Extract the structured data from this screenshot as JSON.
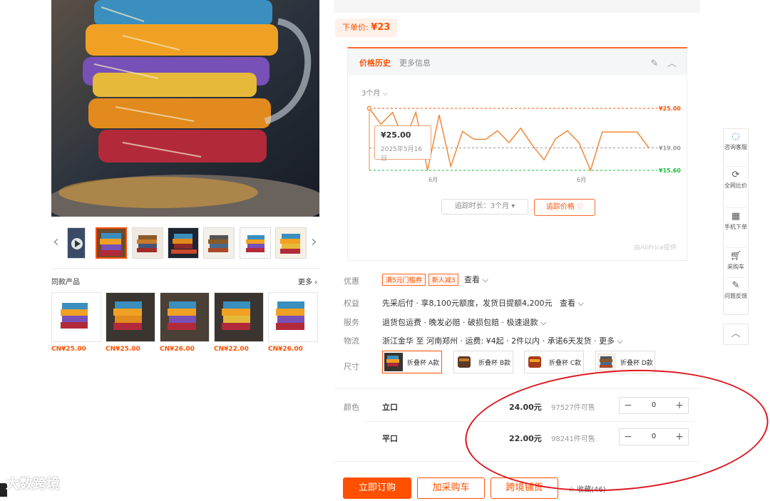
{
  "lowest_price": {
    "label": "下单价:",
    "price": "¥23"
  },
  "price_history": {
    "tab_active": "价格历史",
    "tab_more": "更多信息",
    "period_selector": "3个月",
    "tooltip_price": "¥25.00",
    "tooltip_date": "2025年5月16日",
    "track_duration_button": "追踪时长：3个月",
    "track_price_button": "追踪价格",
    "credit": "由AliPrice提供",
    "colors": {
      "line": "#f0883a",
      "max": "#ff5000",
      "min": "#19be3a"
    }
  },
  "chart_data": {
    "type": "line",
    "x_tick_labels": [
      "6月",
      "6月"
    ],
    "y_labels": [
      "¥25.00",
      "¥19.00",
      "¥15.60"
    ],
    "max": 25.0,
    "mid": 19.0,
    "min": 15.6,
    "series": [
      {
        "values": [
          25.0,
          22.6,
          24.4,
          20.0,
          24.4,
          15.6,
          24.0,
          16.2,
          21.5,
          20.3,
          20.3,
          21.6,
          19.8,
          22.0,
          19.4,
          17.2,
          20.4,
          21.6,
          19.8,
          15.6,
          21.4,
          21.4,
          21.4,
          21.4,
          19.0
        ]
      }
    ]
  },
  "attributes": {
    "promo": {
      "label": "优惠",
      "coupons": [
        "满5元门槛券",
        "新人减3"
      ],
      "link": "查看"
    },
    "rights": {
      "label": "权益",
      "value": "先采后付 · 享8,100元额度，发货日提额4,200元",
      "link": "查看"
    },
    "service": {
      "label": "服务",
      "value": "退货包运费 · 晚发必赔 · 破损包赔 · 极速退款"
    },
    "logistics": {
      "label": "物流",
      "value": "浙江金华 至 河南郑州 · 运费: ¥4起 · 2件以内 · 承诺6天发货 · 更多"
    },
    "size": {
      "label": "尺寸",
      "options": [
        "折叠杯 A款",
        "折叠杯 B款",
        "折叠杯 C款",
        "折叠杯 D款"
      ]
    }
  },
  "color_section": {
    "label": "颜色",
    "variants": [
      {
        "name": "立口",
        "price": "24.00元",
        "stock": "97527件可售",
        "qty": "0"
      },
      {
        "name": "平口",
        "price": "22.00元",
        "stock": "98241件可售",
        "qty": "0"
      }
    ]
  },
  "actions": {
    "buy_now": "立即订购",
    "add_to_cart": "加采购车",
    "cross_border": "跨境铺货",
    "favorite": "收藏(46)"
  },
  "similar": {
    "title": "同款产品",
    "more": "更多",
    "items": [
      {
        "price": "CN¥25.00"
      },
      {
        "price": "CN¥25.00"
      },
      {
        "price": "CN¥26.00"
      },
      {
        "price": "CN¥22.00"
      },
      {
        "price": "CN¥26.00"
      }
    ]
  },
  "float_bar": {
    "items": [
      {
        "label": "咨询客服",
        "icon": "chat-icon"
      },
      {
        "label": "全网比价",
        "icon": "compare-icon"
      },
      {
        "label": "手机下单",
        "icon": "qrcode-icon"
      },
      {
        "label": "采购车",
        "icon": "cart-icon"
      },
      {
        "label": "问题反馈",
        "icon": "feedback-icon"
      }
    ]
  },
  "watermark": "大数跨境"
}
